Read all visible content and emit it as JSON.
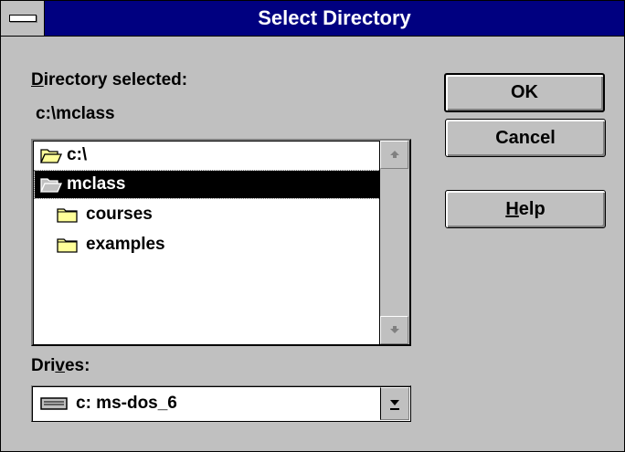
{
  "window": {
    "title": "Select Directory"
  },
  "directory": {
    "label_prefix": "",
    "label_accel": "D",
    "label_rest": "irectory selected:",
    "selected_path": "c:\\mclass"
  },
  "tree": {
    "items": [
      {
        "label": "c:\\",
        "icon": "open-folder-icon",
        "selected": false,
        "indent": 0
      },
      {
        "label": "mclass",
        "icon": "open-folder-icon",
        "selected": true,
        "indent": 0
      },
      {
        "label": "courses",
        "icon": "closed-folder-icon",
        "selected": false,
        "indent": 1
      },
      {
        "label": "examples",
        "icon": "closed-folder-icon",
        "selected": false,
        "indent": 1
      }
    ]
  },
  "drives": {
    "label_prefix": "Dri",
    "label_accel": "v",
    "label_rest": "es:",
    "selected": "c: ms-dos_6",
    "icon": "hard-drive-icon"
  },
  "buttons": {
    "ok": "OK",
    "cancel": "Cancel",
    "help_accel": "H",
    "help_rest": "elp"
  },
  "colors": {
    "title_bar": "#000080",
    "face": "#c0c0c0",
    "selection": "#000000",
    "folder": "#ffff99"
  }
}
